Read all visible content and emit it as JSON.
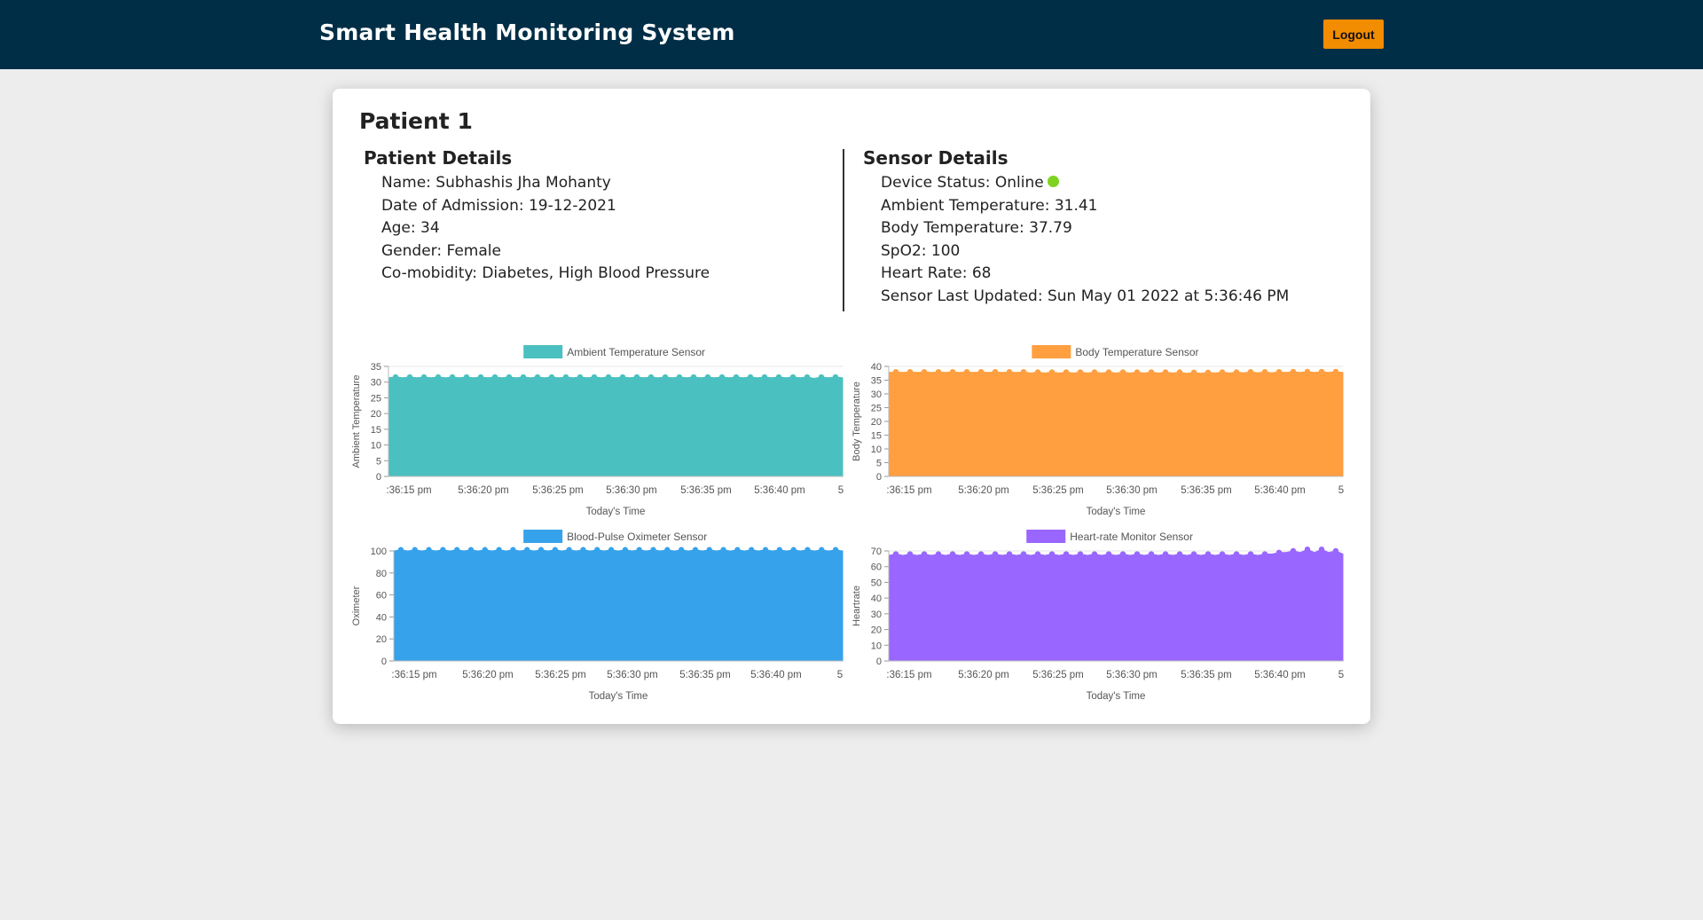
{
  "header": {
    "title": "Smart Health Monitoring System",
    "logout_label": "Logout"
  },
  "patient": {
    "title": "Patient 1",
    "details_heading": "Patient Details",
    "details": [
      "Name: Subhashis Jha Mohanty",
      "Date of Admission: 19-12-2021",
      "Age: 34",
      "Gender: Female",
      "Co-mobidity: Diabetes, High Blood Pressure"
    ]
  },
  "sensor": {
    "heading": "Sensor Details",
    "status_label": "Device Status: Online",
    "status_color": "#7ed321",
    "details": [
      "Ambient Temperature: 31.41",
      "Body Temperature: 37.79",
      "SpO2: 100",
      "Heart Rate: 68",
      "Sensor Last Updated: Sun May 01 2022 at 5:36:46 PM"
    ]
  },
  "chart_data": [
    {
      "type": "area",
      "legend": "Ambient Temperature Sensor",
      "color": "#4bc0c0",
      "ylabel": "Ambient Temperature",
      "xlabel": "Today's Time",
      "ylim": [
        0,
        35
      ],
      "yticks": [
        0,
        5,
        10,
        15,
        20,
        25,
        30,
        35
      ],
      "xticks": [
        ":36:15 pm",
        "5:36:20 pm",
        "5:36:25 pm",
        "5:36:30 pm",
        "5:36:35 pm",
        "5:36:40 pm",
        "5"
      ],
      "values": [
        31.4,
        31.6,
        31.4,
        31.6,
        31.4,
        31.6,
        31.4,
        31.6,
        31.4,
        31.6,
        31.4,
        31.6,
        31.4,
        31.6,
        31.4,
        31.6,
        31.4,
        31.6,
        31.4,
        31.6,
        31.4,
        31.6,
        31.4,
        31.6,
        31.4,
        31.6,
        31.4,
        31.6,
        31.4,
        31.6,
        31.4,
        31.6,
        31.4,
        31.6,
        31.4,
        31.6,
        31.4,
        31.6,
        31.4,
        31.6,
        31.4,
        31.6,
        31.4,
        31.6,
        31.4,
        31.6,
        31.4,
        31.6,
        31.4,
        31.6,
        31.4,
        31.6,
        31.4,
        31.6,
        31.4,
        31.6,
        31.4,
        31.6,
        31.4,
        31.6,
        31.2,
        31.6,
        31.4,
        31.6,
        31.4
      ]
    },
    {
      "type": "area",
      "legend": "Body Temperature Sensor",
      "color": "#ff9f40",
      "ylabel": "Body Temperature",
      "xlabel": "Today's Time",
      "ylim": [
        0,
        40
      ],
      "yticks": [
        0,
        5,
        10,
        15,
        20,
        25,
        30,
        35,
        40
      ],
      "xticks": [
        ":36:15 pm",
        "5:36:20 pm",
        "5:36:25 pm",
        "5:36:30 pm",
        "5:36:35 pm",
        "5:36:40 pm",
        "5"
      ],
      "values": [
        37.8,
        38.0,
        37.8,
        38.0,
        37.8,
        38.0,
        37.8,
        38.0,
        37.8,
        38.0,
        37.8,
        38.0,
        37.8,
        38.0,
        37.8,
        38.0,
        37.8,
        38.0,
        37.8,
        38.0,
        37.6,
        37.9,
        37.6,
        37.9,
        37.6,
        37.9,
        37.6,
        37.9,
        37.6,
        37.9,
        37.6,
        37.9,
        37.6,
        37.9,
        37.6,
        37.9,
        37.6,
        37.9,
        37.6,
        37.9,
        37.6,
        37.9,
        37.5,
        37.8,
        37.5,
        37.8,
        37.6,
        37.9,
        37.6,
        37.9,
        37.7,
        38.0,
        37.7,
        38.0,
        37.7,
        38.0,
        37.8,
        38.1,
        37.8,
        38.1,
        37.8,
        38.1,
        37.8,
        38.1,
        37.8
      ]
    },
    {
      "type": "area",
      "legend": "Blood-Pulse Oximeter Sensor",
      "color": "#36a2eb",
      "ylabel": "Oximeter",
      "xlabel": "Today's Time",
      "ylim": [
        0,
        100
      ],
      "yticks": [
        0,
        20,
        40,
        60,
        80,
        100
      ],
      "xticks": [
        ":36:15 pm",
        "5:36:20 pm",
        "5:36:25 pm",
        "5:36:30 pm",
        "5:36:35 pm",
        "5:36:40 pm",
        "5"
      ],
      "values": [
        100,
        101,
        100,
        101,
        100,
        101,
        100,
        101,
        100,
        101,
        100,
        101,
        100,
        101,
        100,
        101,
        100,
        101,
        100,
        101,
        100,
        101,
        100,
        101,
        100,
        101,
        100,
        101,
        100,
        101,
        100,
        101,
        100,
        101,
        100,
        101,
        100,
        101,
        100,
        101,
        100,
        101,
        100,
        101,
        100,
        101,
        100,
        101,
        100,
        101,
        100,
        101,
        100,
        101,
        100,
        101,
        100,
        101,
        100,
        101,
        100,
        101,
        100,
        101,
        100
      ]
    },
    {
      "type": "area",
      "legend": "Heart-rate Monitor Sensor",
      "color": "#9966ff",
      "ylabel": "Heartrate",
      "xlabel": "Today's Time",
      "ylim": [
        0,
        70
      ],
      "yticks": [
        0,
        10,
        20,
        30,
        40,
        50,
        60,
        70
      ],
      "xticks": [
        ":36:15 pm",
        "5:36:20 pm",
        "5:36:25 pm",
        "5:36:30 pm",
        "5:36:35 pm",
        "5:36:40 pm",
        "5"
      ],
      "values": [
        67.2,
        68,
        67.2,
        68,
        67.2,
        68,
        67.2,
        68,
        67.2,
        68,
        67.2,
        68,
        67.2,
        68,
        67.2,
        68,
        67.2,
        68,
        67.2,
        68,
        67.2,
        68,
        67.2,
        68,
        67.2,
        68,
        67.2,
        68,
        67.2,
        68,
        67.2,
        68,
        67.2,
        68,
        67.2,
        68,
        67.2,
        68,
        67.2,
        68,
        67.2,
        68,
        67.2,
        68,
        67.2,
        68,
        67.2,
        68,
        67.2,
        68,
        67.2,
        68,
        67.2,
        68,
        68,
        69,
        69,
        70,
        69,
        71,
        69,
        71,
        69,
        70,
        68
      ]
    }
  ]
}
